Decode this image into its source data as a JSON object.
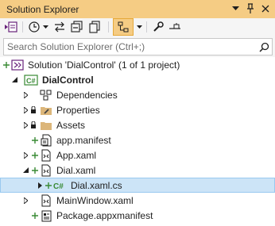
{
  "window": {
    "title": "Solution Explorer"
  },
  "titlebar_icons": [
    "chevron-down-icon",
    "pin-icon",
    "close-icon"
  ],
  "toolbar": {
    "icons": [
      "switch-views-icon",
      "history-icon",
      "dropdown-icon",
      "sync-icon",
      "collapse-all-icon",
      "show-all-files-icon",
      "filter-icon",
      "dropdown-icon",
      "properties-icon",
      "preview-icon"
    ]
  },
  "search": {
    "placeholder": "Search Solution Explorer (Ctrl+;)"
  },
  "tree": {
    "solution": "Solution 'DialControl' (1 of 1 project)",
    "project": "DialControl",
    "items": [
      {
        "label": "Dependencies",
        "icon": "dependencies-icon"
      },
      {
        "label": "Properties",
        "icon": "folder-wrench-icon"
      },
      {
        "label": "Assets",
        "icon": "folder-icon"
      },
      {
        "label": "app.manifest",
        "icon": "manifest-icon"
      },
      {
        "label": "App.xaml",
        "icon": "xaml-file-icon"
      },
      {
        "label": "Dial.xaml",
        "icon": "xaml-file-icon"
      },
      {
        "label": "Dial.xaml.cs",
        "icon": "csharp-file-icon"
      },
      {
        "label": "MainWindow.xaml",
        "icon": "xaml-file-icon"
      },
      {
        "label": "Package.appxmanifest",
        "icon": "package-manifest-icon"
      }
    ]
  },
  "colors": {
    "titlebar": "#f5cc84",
    "selection": "#cce4f7",
    "selection_border": "#99c9ef",
    "csharp_green": "#388a34",
    "folder": "#dcb67a",
    "vs_purple": "#68217a"
  }
}
